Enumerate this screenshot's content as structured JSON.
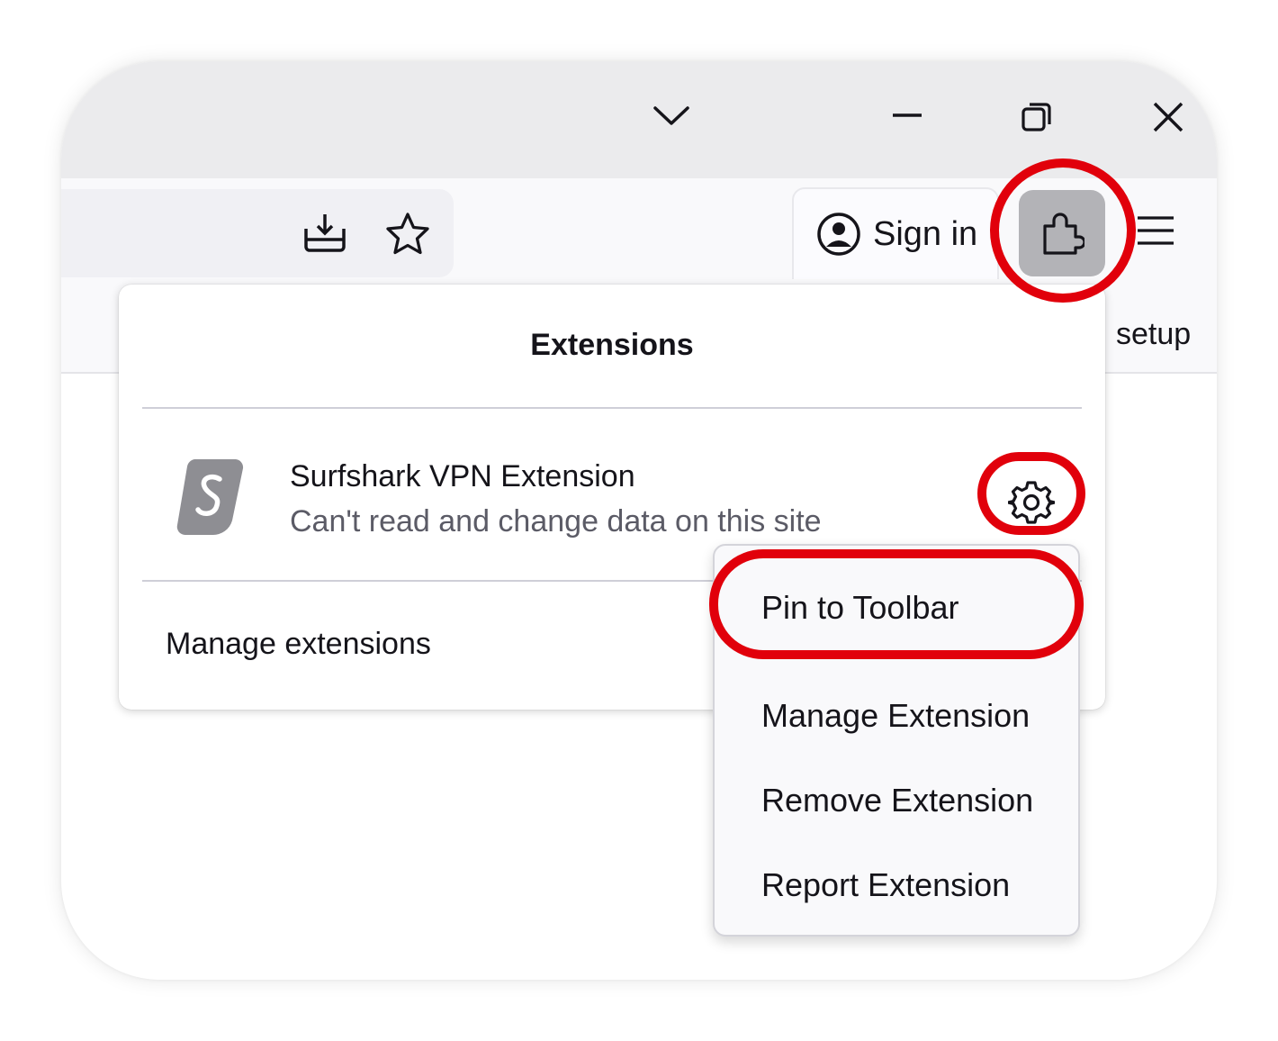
{
  "toolbar": {
    "sign_in_label": "Sign in"
  },
  "bookmarks": {
    "visible_item": "setup"
  },
  "extensions_panel": {
    "title": "Extensions",
    "extension": {
      "name": "Surfshark VPN Extension",
      "status": "Can't read and change data on this site"
    },
    "manage_label": "Manage extensions"
  },
  "context_menu": {
    "items": [
      "Pin to Toolbar",
      "Manage Extension",
      "Remove Extension",
      "Report Extension"
    ]
  },
  "colors": {
    "highlight": "#e1000b",
    "extensions_button_bg": "#b3b3b7",
    "titlebar_bg": "#ebebed"
  }
}
